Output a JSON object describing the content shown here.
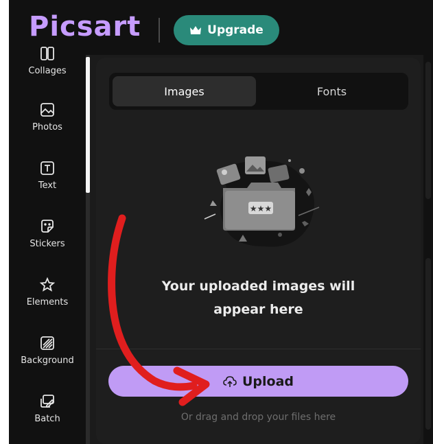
{
  "brand": {
    "logo_text": "Picsart",
    "logo_color": "#c69cff"
  },
  "header": {
    "upgrade_label": "Upgrade",
    "upgrade_color": "#2a8a7a"
  },
  "sidebar": {
    "items": [
      {
        "label": "Collages",
        "icon": "collage-icon"
      },
      {
        "label": "Photos",
        "icon": "photo-icon"
      },
      {
        "label": "Text",
        "icon": "text-icon"
      },
      {
        "label": "Stickers",
        "icon": "sticker-icon"
      },
      {
        "label": "Elements",
        "icon": "star-icon"
      },
      {
        "label": "Background",
        "icon": "background-icon"
      },
      {
        "label": "Batch",
        "icon": "batch-icon"
      }
    ]
  },
  "panel": {
    "tabs": [
      {
        "label": "Images",
        "active": true
      },
      {
        "label": "Fonts",
        "active": false
      }
    ],
    "empty_title_line1": "Your uploaded images will",
    "empty_title_line2": "appear here",
    "upload_label": "Upload",
    "upload_color": "#c09bf5",
    "drag_drop_hint": "Or drag and drop your files here"
  },
  "annotation": {
    "arrow_color": "#e01e1e"
  }
}
